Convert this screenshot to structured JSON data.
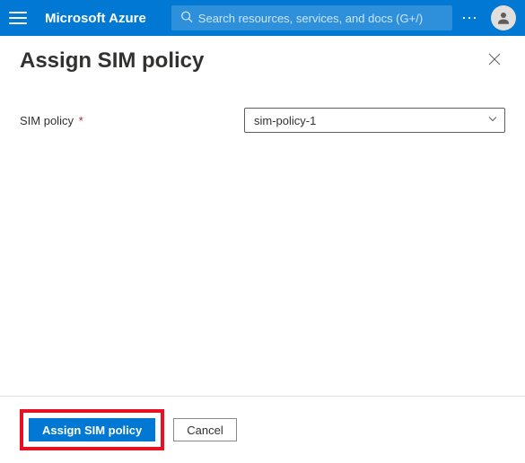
{
  "header": {
    "brand": "Microsoft Azure",
    "search_placeholder": "Search resources, services, and docs (G+/)"
  },
  "panel": {
    "title": "Assign SIM policy"
  },
  "form": {
    "sim_policy_label": "SIM policy",
    "required_marker": "*",
    "sim_policy_value": "sim-policy-1"
  },
  "footer": {
    "submit_label": "Assign SIM policy",
    "cancel_label": "Cancel"
  }
}
